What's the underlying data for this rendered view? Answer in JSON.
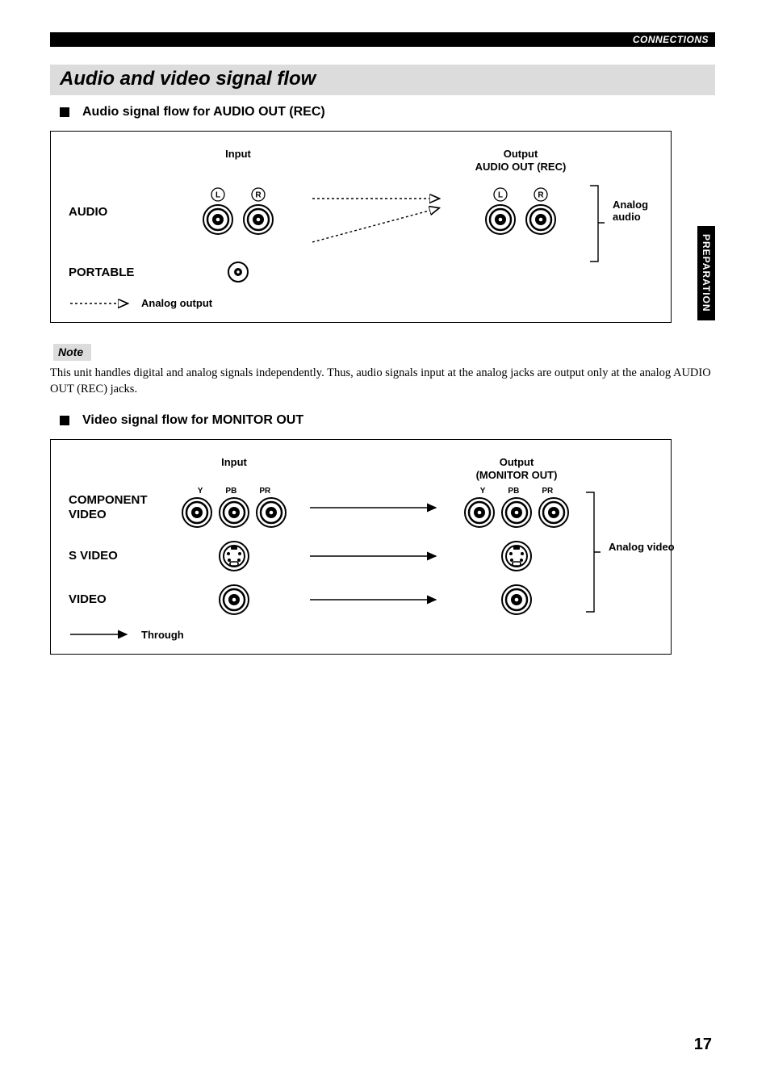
{
  "header": {
    "section": "CONNECTIONS"
  },
  "sideTab": "PREPARATION",
  "title": "Audio and video signal flow",
  "audio": {
    "heading": "Audio signal flow for AUDIO OUT (REC)",
    "inputLabel": "Input",
    "outputLabel1": "Output",
    "outputLabel2": "AUDIO OUT (REC)",
    "rows": {
      "audio": "AUDIO",
      "portable": "PORTABLE"
    },
    "jackLabels": {
      "left": "L",
      "right": "R"
    },
    "rightLabel": "Analog audio",
    "legend": "Analog output"
  },
  "note": {
    "label": "Note",
    "text": "This unit handles digital and analog signals independently. Thus, audio signals input at the analog jacks are output only at the analog AUDIO OUT (REC) jacks."
  },
  "video": {
    "heading": "Video signal flow for MONITOR OUT",
    "inputLabel": "Input",
    "outputLabel1": "Output",
    "outputLabel2": "(MONITOR OUT)",
    "rows": {
      "component": "COMPONENT VIDEO",
      "svideo": "S VIDEO",
      "video": "VIDEO"
    },
    "compLabels": {
      "y": "Y",
      "pb": "PB",
      "pr": "PR"
    },
    "rightLabel": "Analog video",
    "legend": "Through"
  },
  "pageNumber": "17"
}
